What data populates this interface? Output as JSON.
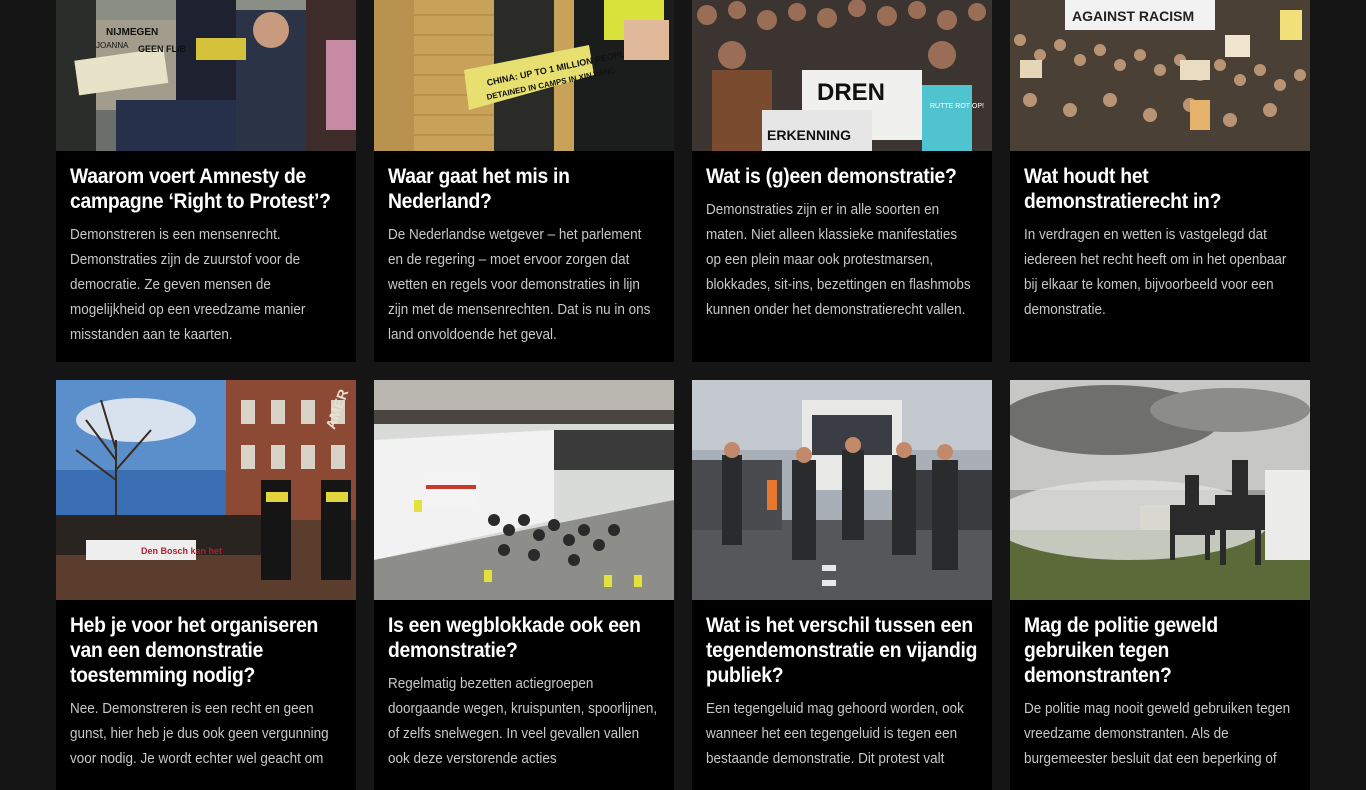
{
  "cards": [
    {
      "title": "Waarom voert Amnesty de campagne ‘Right to Protest’?",
      "text": "Demonstreren is een mensenrecht. Demonstraties zijn de zuurstof voor de democratie. Ze geven mensen de mogelijkheid op een vreedzame manier misstanden aan te kaarten.",
      "image_alt": "protesters with signs",
      "image_signs": [
        "NIJMEGEN",
        "GEEN FLIB",
        "JOANNA"
      ]
    },
    {
      "title": "Waar gaat het mis in Nederland?",
      "text": "De Nederlandse wetgever – het parlement en de regering – moet ervoor zorgen dat wetten en regels voor demonstraties in lijn zijn met de mensenrechten. Dat is nu in ons land onvoldoende het geval.",
      "image_alt": "police holding a protest banner",
      "image_signs": [
        "CHINA: UP TO 1 MILLION PEOPLE",
        "DETAINED IN CAMPS IN XINJIANG"
      ]
    },
    {
      "title": "Wat is (g)een demonstratie?",
      "text": "Demonstraties zijn er in alle soorten en maten. Niet alleen klassieke manifestaties op een plein maar ook protestmarsen, blokkades, sit-ins, bezettingen en flashmobs kunnen onder het demonstratierecht vallen.",
      "image_alt": "crowd with banners",
      "image_signs": [
        "DREN",
        "ERKENNING",
        "RUTTE ROT OP!"
      ]
    },
    {
      "title": "Wat houdt het demonstratierecht in?",
      "text": "In verdragen en wetten is vastgelegd dat iedereen het recht heeft om in het openbaar bij elkaar te komen, bijvoorbeeld voor een demonstratie.",
      "image_alt": "large crowd demonstrating",
      "image_signs": [
        "AGAINST RACISM"
      ]
    },
    {
      "title": "Heb je voor het organiseren van een demonstratie toestemming nodig?",
      "text": "Nee. Demonstreren is een recht en geen gunst, hier heb je dus ook geen vergunning voor nodig. Je wordt echter wel geacht om",
      "image_alt": "police in front of demonstrators on a street",
      "image_signs": [
        "Den Bosch kan het",
        "AMER"
      ]
    },
    {
      "title": "Is een wegblokkade ook een demonstratie?",
      "text": "Regelmatig bezetten actiegroepen doorgaande wegen, kruispunten, spoorlijnen, of zelfs snelwegen. In veel gevallen vallen ook deze verstorende acties",
      "image_alt": "highway blockade with police",
      "image_signs": []
    },
    {
      "title": "Wat is het verschil tussen een tegendemonstratie en vijandig publiek?",
      "text": "Een tegengeluid mag gehoord worden, ook wanneer het een tegengeluid is tegen een bestaande demonstratie. Dit protest valt",
      "image_alt": "men standing on a road in front of a bus",
      "image_signs": []
    },
    {
      "title": "Mag de politie geweld gebruiken tegen demonstranten?",
      "text": "De politie mag nooit geweld gebruiken tegen vreedzame demonstranten. Als de burgemeester besluit dat een beperking of",
      "image_alt": "mounted police and water cannon",
      "image_signs": []
    }
  ]
}
